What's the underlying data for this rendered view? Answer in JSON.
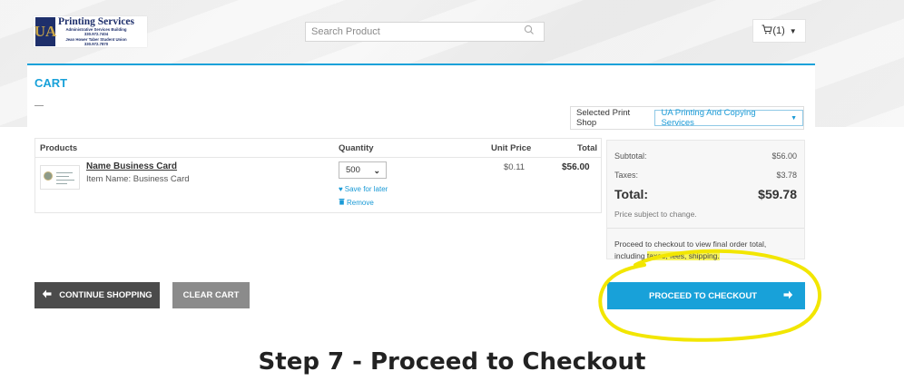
{
  "header": {
    "logo": {
      "mark": "UA",
      "title": "Printing Services",
      "line1": "Administrative Services Building",
      "line2": "330.972.7404",
      "line3": "Jean Hower Taber Student Union",
      "line4": "330.972.7870"
    },
    "search": {
      "placeholder": "Search Product",
      "icon": "search-icon"
    },
    "cart": {
      "icon": "cart-icon",
      "count_label": "(1)"
    }
  },
  "cart": {
    "title": "CART",
    "print_shop": {
      "label": "Selected Print Shop",
      "value": "UA Printing And Copying Services"
    },
    "table": {
      "headers": {
        "products": "Products",
        "quantity": "Quantity",
        "unit_price": "Unit Price",
        "total": "Total"
      },
      "items": [
        {
          "name": "Name Business Card",
          "item_name": "Item Name: Business Card",
          "quantity": "500",
          "save_for_later": "Save for later",
          "remove": "Remove",
          "unit_price": "$0.11",
          "total": "$56.00"
        }
      ]
    },
    "summary": {
      "subtotal_label": "Subtotal:",
      "subtotal_value": "$56.00",
      "taxes_label": "Taxes:",
      "taxes_value": "$3.78",
      "total_label": "Total:",
      "total_value": "$59.78",
      "price_note": "Price subject to change.",
      "checkout_note_a": "Proceed to checkout to view final order total, including ",
      "checkout_note_b": "taxes, fees, shipping."
    },
    "buttons": {
      "continue": "CONTINUE SHOPPING",
      "clear": "CLEAR CART",
      "checkout": "PROCEED TO CHECKOUT"
    }
  },
  "annotation": {
    "caption": "Step 7 - Proceed to Checkout",
    "highlight_color": "#f7f35a",
    "circle_color": "#f2e600"
  },
  "colors": {
    "accent": "#18a1d9",
    "dark_button": "#4b4b4b",
    "gray_button": "#8b8b8b",
    "brand_navy": "#1e2f6b"
  }
}
